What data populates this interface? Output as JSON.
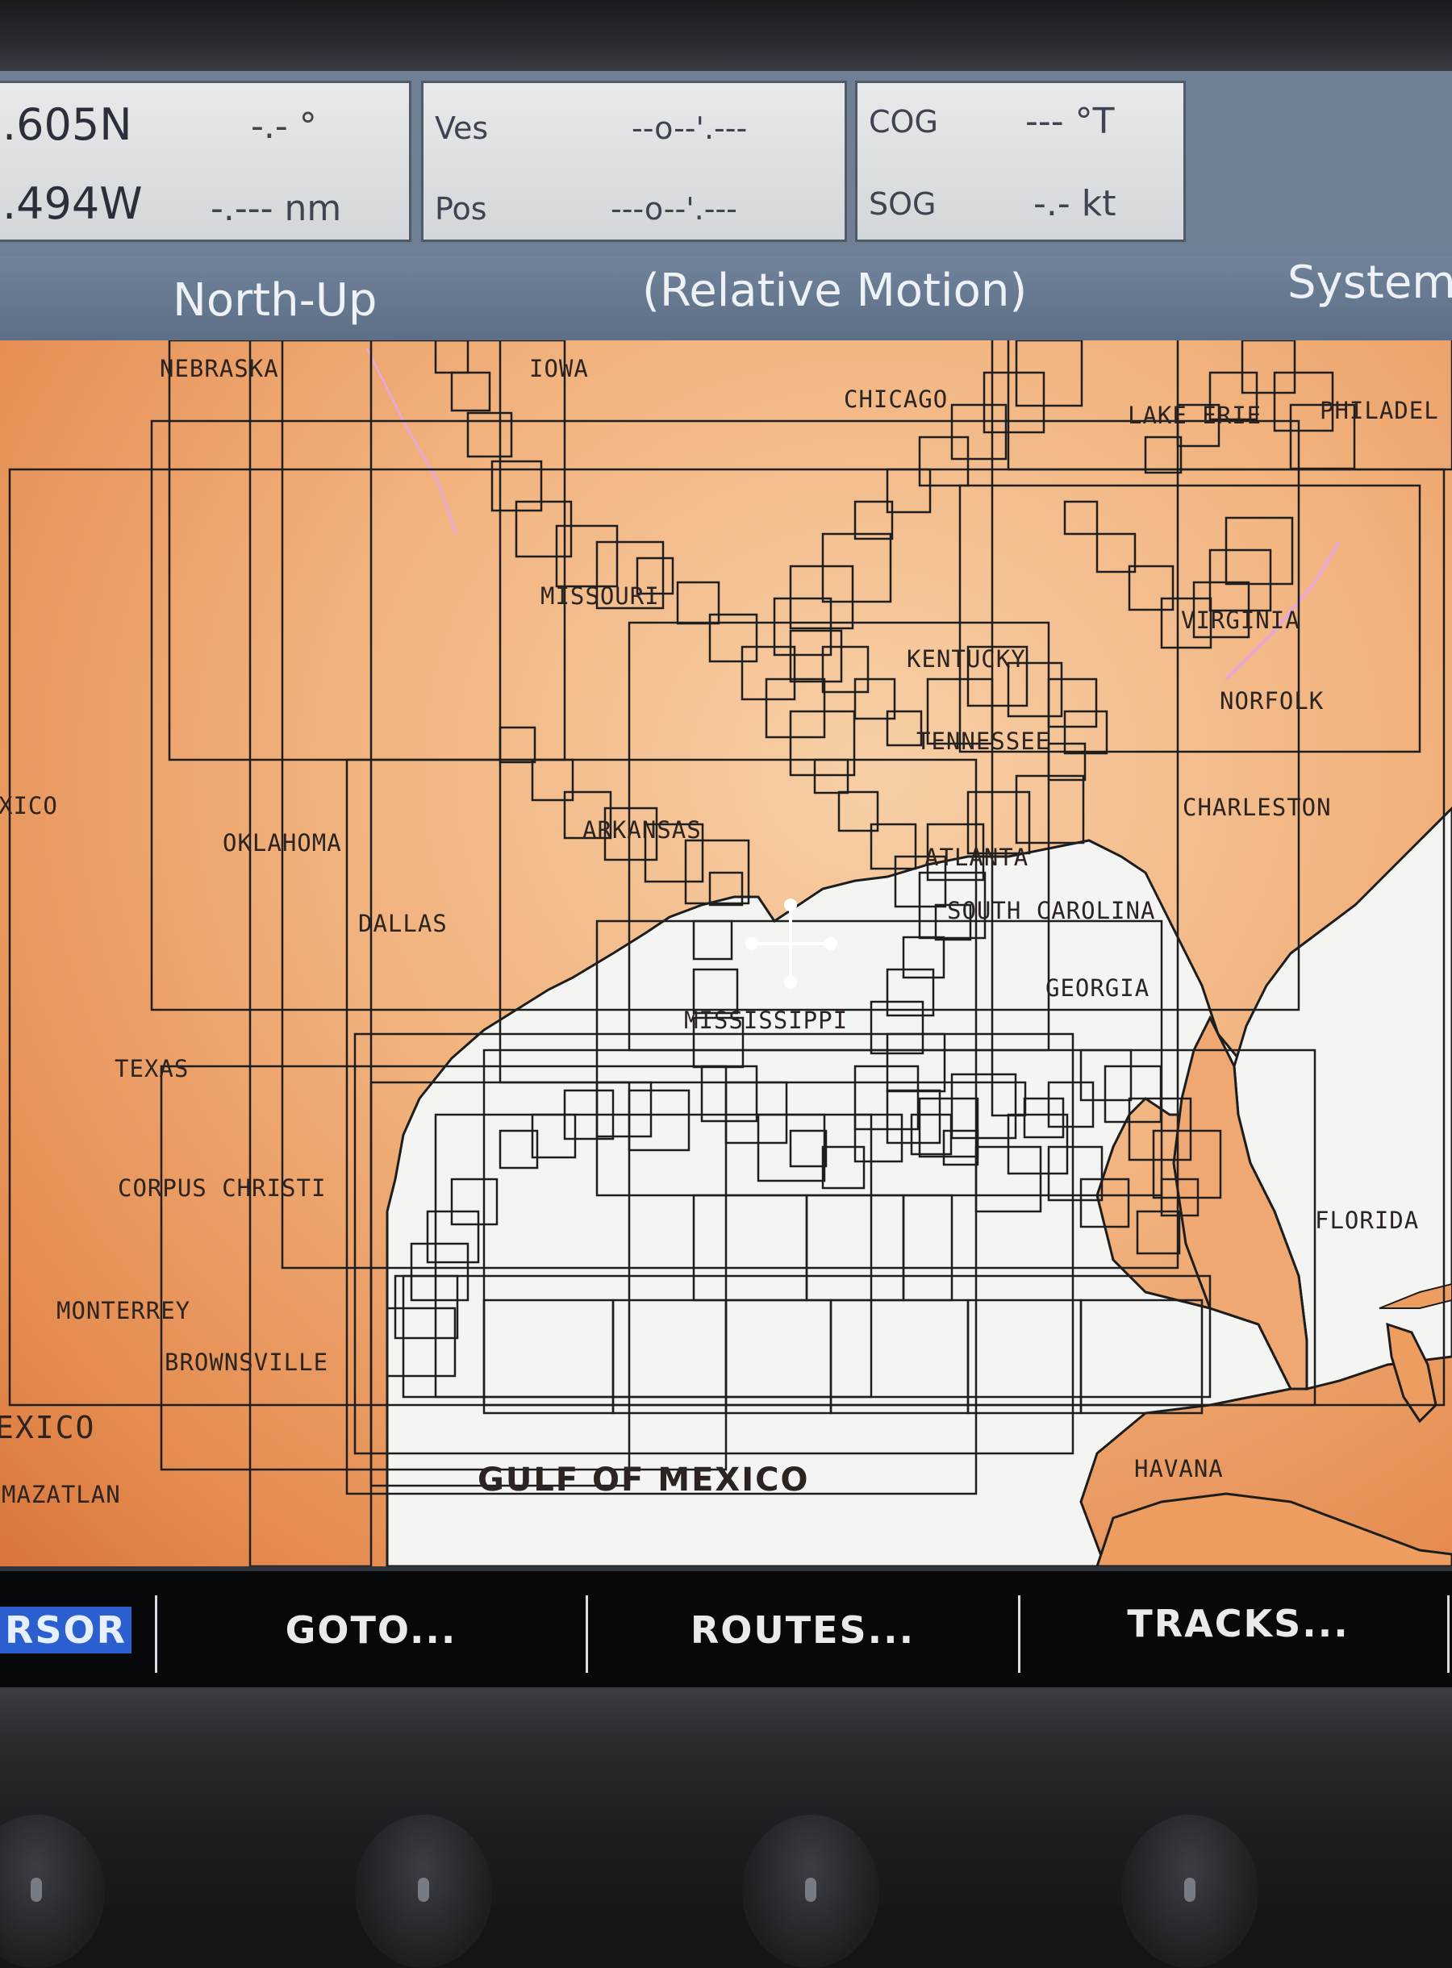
{
  "header": {
    "position": {
      "lat": ".605N",
      "lon": ".494W",
      "bearing": "-.- °",
      "range": "-.--- nm"
    },
    "vessel": {
      "label_ves": "Ves",
      "label_pos": "Pos",
      "ves_value": "--o--'.---",
      "pos_value": "---o--'.---"
    },
    "course": {
      "cog_label": "COG",
      "cog_value": "--- °T",
      "sog_label": "SOG",
      "sog_value": "-.- kt"
    }
  },
  "modebar": {
    "orientation": "North-Up",
    "motion": "(Relative Motion)",
    "system": "System"
  },
  "chart": {
    "places": [
      {
        "key": "nebraska",
        "text": "NEBRASKA"
      },
      {
        "key": "iowa",
        "text": "IOWA"
      },
      {
        "key": "chicago",
        "text": "CHICAGO"
      },
      {
        "key": "lake-erie",
        "text": "LAKE ERIE"
      },
      {
        "key": "philadel",
        "text": "PHILADEL"
      },
      {
        "key": "missouri",
        "text": "MISSOURI"
      },
      {
        "key": "virginia",
        "text": "VIRGINIA"
      },
      {
        "key": "kentucky",
        "text": "KENTUCKY"
      },
      {
        "key": "norfolk",
        "text": "NORFOLK"
      },
      {
        "key": "tennessee",
        "text": "TENNESSEE"
      },
      {
        "key": "xico",
        "text": "XICO"
      },
      {
        "key": "charleston",
        "text": "CHARLESTON"
      },
      {
        "key": "oklahoma",
        "text": "OKLAHOMA"
      },
      {
        "key": "arkansas",
        "text": "ARKANSAS"
      },
      {
        "key": "atlanta",
        "text": "ATLANTA"
      },
      {
        "key": "dallas",
        "text": "DALLAS"
      },
      {
        "key": "south-carolina",
        "text": "SOUTH CAROLINA"
      },
      {
        "key": "georgia",
        "text": "GEORGIA"
      },
      {
        "key": "mississippi",
        "text": "MISSISSIPPI"
      },
      {
        "key": "texas",
        "text": "TEXAS"
      },
      {
        "key": "corpus-christi",
        "text": "CORPUS CHRISTI"
      },
      {
        "key": "florida",
        "text": "FLORIDA"
      },
      {
        "key": "monterrey",
        "text": "MONTERREY"
      },
      {
        "key": "brownsville",
        "text": "BROWNSVILLE"
      },
      {
        "key": "exico",
        "text": "EXICO"
      },
      {
        "key": "havana",
        "text": "HAVANA"
      },
      {
        "key": "mazatlan",
        "text": "MAZATLAN"
      },
      {
        "key": "gulf-of-mexico",
        "text": "GULF OF MEXICO"
      }
    ]
  },
  "softkeys": [
    {
      "key": "cursor",
      "label": "RSOR",
      "selected": true
    },
    {
      "key": "goto",
      "label": "GOTO..."
    },
    {
      "key": "routes",
      "label": "ROUTES..."
    },
    {
      "key": "tracks",
      "label": "TRACKS..."
    }
  ],
  "colors": {
    "land": "#f1b17c",
    "water": "#f4f5f3",
    "panel": "#dfe2e4",
    "modebar": "#6a7c93",
    "softbar": "#07080a",
    "selected": "#2b5fcf"
  },
  "icons": {
    "cursor": "crosshair-cursor-icon"
  }
}
